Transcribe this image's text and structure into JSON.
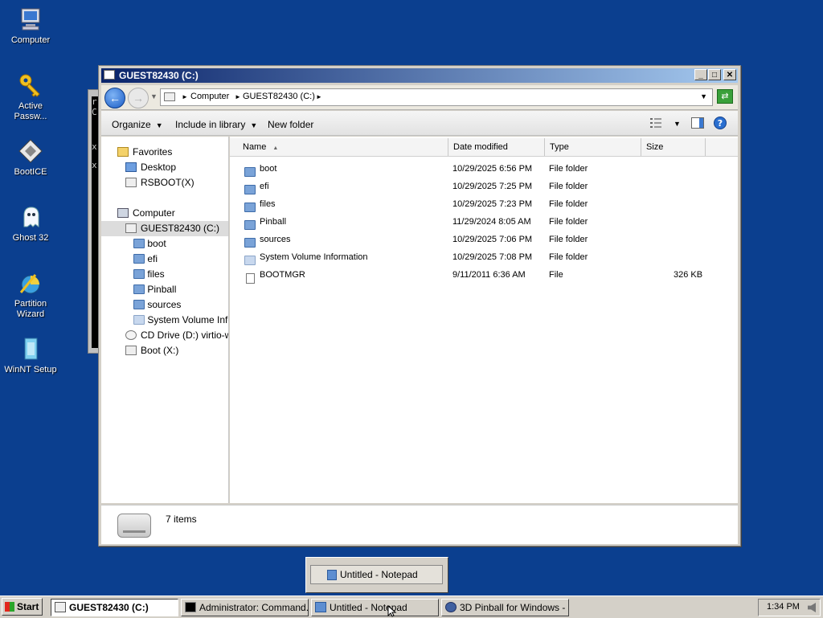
{
  "desktop": {
    "icons": [
      {
        "label_1": "Computer",
        "label_2": "",
        "icon": "computer-icon"
      },
      {
        "label_1": "Active",
        "label_2": "Passw...",
        "icon": "key-icon"
      },
      {
        "label_1": "BootICE",
        "label_2": "",
        "icon": "bootice-icon"
      },
      {
        "label_1": "Ghost 32",
        "label_2": "",
        "icon": "ghost-icon"
      },
      {
        "label_1": "Partition",
        "label_2": "Wizard",
        "icon": "partition-wizard-icon"
      },
      {
        "label_1": "WinNT Setup",
        "label_2": "",
        "icon": "winnt-setup-icon"
      }
    ]
  },
  "background_console": {
    "lines": [
      "r",
      "C",
      "",
      "",
      "",
      "",
      "x",
      "",
      "",
      "",
      "",
      "x"
    ]
  },
  "explorer": {
    "title": "GUEST82430 (C:)",
    "buttons": {
      "minimize": "_",
      "maximize": "□",
      "close": "✕"
    },
    "address": {
      "segments": [
        "Computer",
        "GUEST82430 (C:)"
      ]
    },
    "commands": {
      "organize": "Organize",
      "include_in_library": "Include in library",
      "new_folder": "New folder"
    },
    "nav": {
      "favorites": "Favorites",
      "desktop": "Desktop",
      "rsboot": "RSBOOT(X)",
      "computer": "Computer",
      "drive_c": "GUEST82430 (C:)",
      "children": [
        "boot",
        "efi",
        "files",
        "Pinball",
        "sources",
        "System Volume Information"
      ],
      "cd_drive": "CD Drive (D:) virtio-win",
      "boot": "Boot (X:)"
    },
    "columns": {
      "name": "Name",
      "date": "Date modified",
      "type": "Type",
      "size": "Size"
    },
    "files": [
      {
        "name": "boot",
        "date": "10/29/2025 6:56 PM",
        "type": "File folder",
        "size": ""
      },
      {
        "name": "efi",
        "date": "10/29/2025 7:25 PM",
        "type": "File folder",
        "size": ""
      },
      {
        "name": "files",
        "date": "10/29/2025 7:23 PM",
        "type": "File folder",
        "size": ""
      },
      {
        "name": "Pinball",
        "date": "11/29/2024 8:05 AM",
        "type": "File folder",
        "size": ""
      },
      {
        "name": "sources",
        "date": "10/29/2025 7:06 PM",
        "type": "File folder",
        "size": ""
      },
      {
        "name": "System Volume Information",
        "date": "10/29/2025 7:08 PM",
        "type": "File folder",
        "size": ""
      },
      {
        "name": "BOOTMGR",
        "date": "9/11/2011 6:36 AM",
        "type": "File",
        "size": "326 KB"
      }
    ],
    "status": {
      "items": "7 items"
    }
  },
  "popup": {
    "label": "Untitled - Notepad"
  },
  "taskbar": {
    "start": "Start",
    "tasks": [
      {
        "label": "GUEST82430 (C:)",
        "active": true
      },
      {
        "label": "Administrator: Command...",
        "active": false
      },
      {
        "label": "Untitled - Notepad",
        "active": false
      },
      {
        "label": "3D Pinball for Windows - ...",
        "active": false
      }
    ],
    "clock": "1:34 PM"
  }
}
